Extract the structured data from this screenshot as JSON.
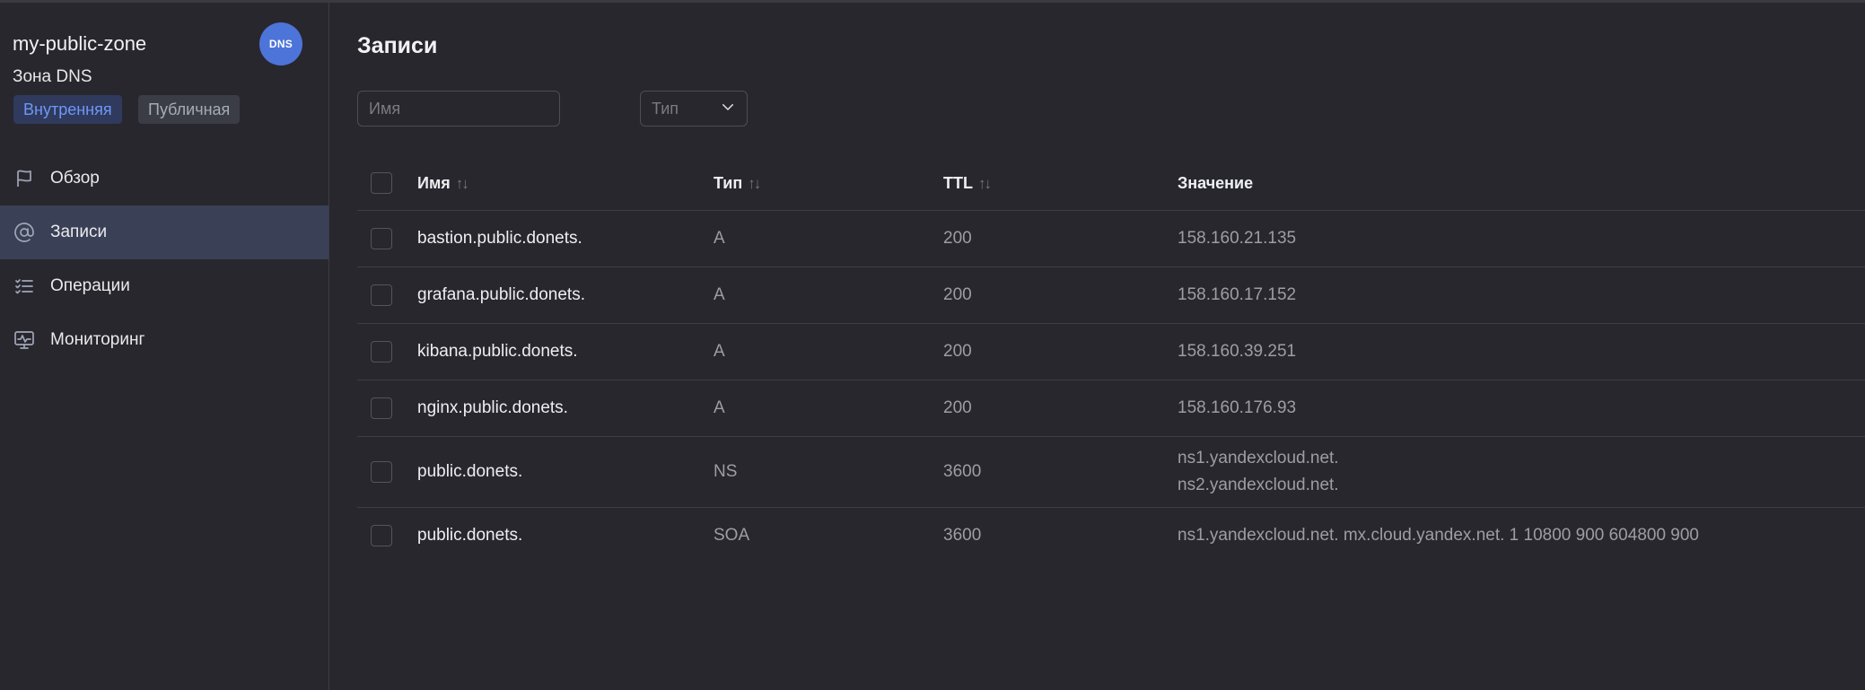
{
  "zone": {
    "name": "my-public-zone",
    "subtitle": "Зона DNS",
    "badge": "DNS",
    "tags": [
      "Внутренняя",
      "Публичная"
    ]
  },
  "nav": [
    {
      "label": "Обзор",
      "icon": "flag-icon"
    },
    {
      "label": "Записи",
      "icon": "at-icon"
    },
    {
      "label": "Операции",
      "icon": "checklist-icon"
    },
    {
      "label": "Мониторинг",
      "icon": "monitor-icon"
    }
  ],
  "page": {
    "title": "Записи",
    "name_placeholder": "Имя",
    "type_placeholder": "Тип"
  },
  "table": {
    "headers": {
      "name": "Имя",
      "type": "Тип",
      "ttl": "TTL",
      "value": "Значение",
      "sort_glyph": "↑↓"
    },
    "rows": [
      {
        "name": "bastion.public.donets.",
        "type": "A",
        "ttl": "200",
        "value": [
          "158.160.21.135"
        ]
      },
      {
        "name": "grafana.public.donets.",
        "type": "A",
        "ttl": "200",
        "value": [
          "158.160.17.152"
        ]
      },
      {
        "name": "kibana.public.donets.",
        "type": "A",
        "ttl": "200",
        "value": [
          "158.160.39.251"
        ]
      },
      {
        "name": "nginx.public.donets.",
        "type": "A",
        "ttl": "200",
        "value": [
          "158.160.176.93"
        ]
      },
      {
        "name": "public.donets.",
        "type": "NS",
        "ttl": "3600",
        "value": [
          "ns1.yandexcloud.net.",
          "ns2.yandexcloud.net."
        ]
      },
      {
        "name": "public.donets.",
        "type": "SOA",
        "ttl": "3600",
        "value": [
          "ns1.yandexcloud.net. mx.cloud.yandex.net. 1 10800 900 604800 900"
        ]
      }
    ]
  },
  "colors": {
    "accent": "#4d74d9",
    "active_nav": "#3a4056",
    "background": "#28272d"
  }
}
